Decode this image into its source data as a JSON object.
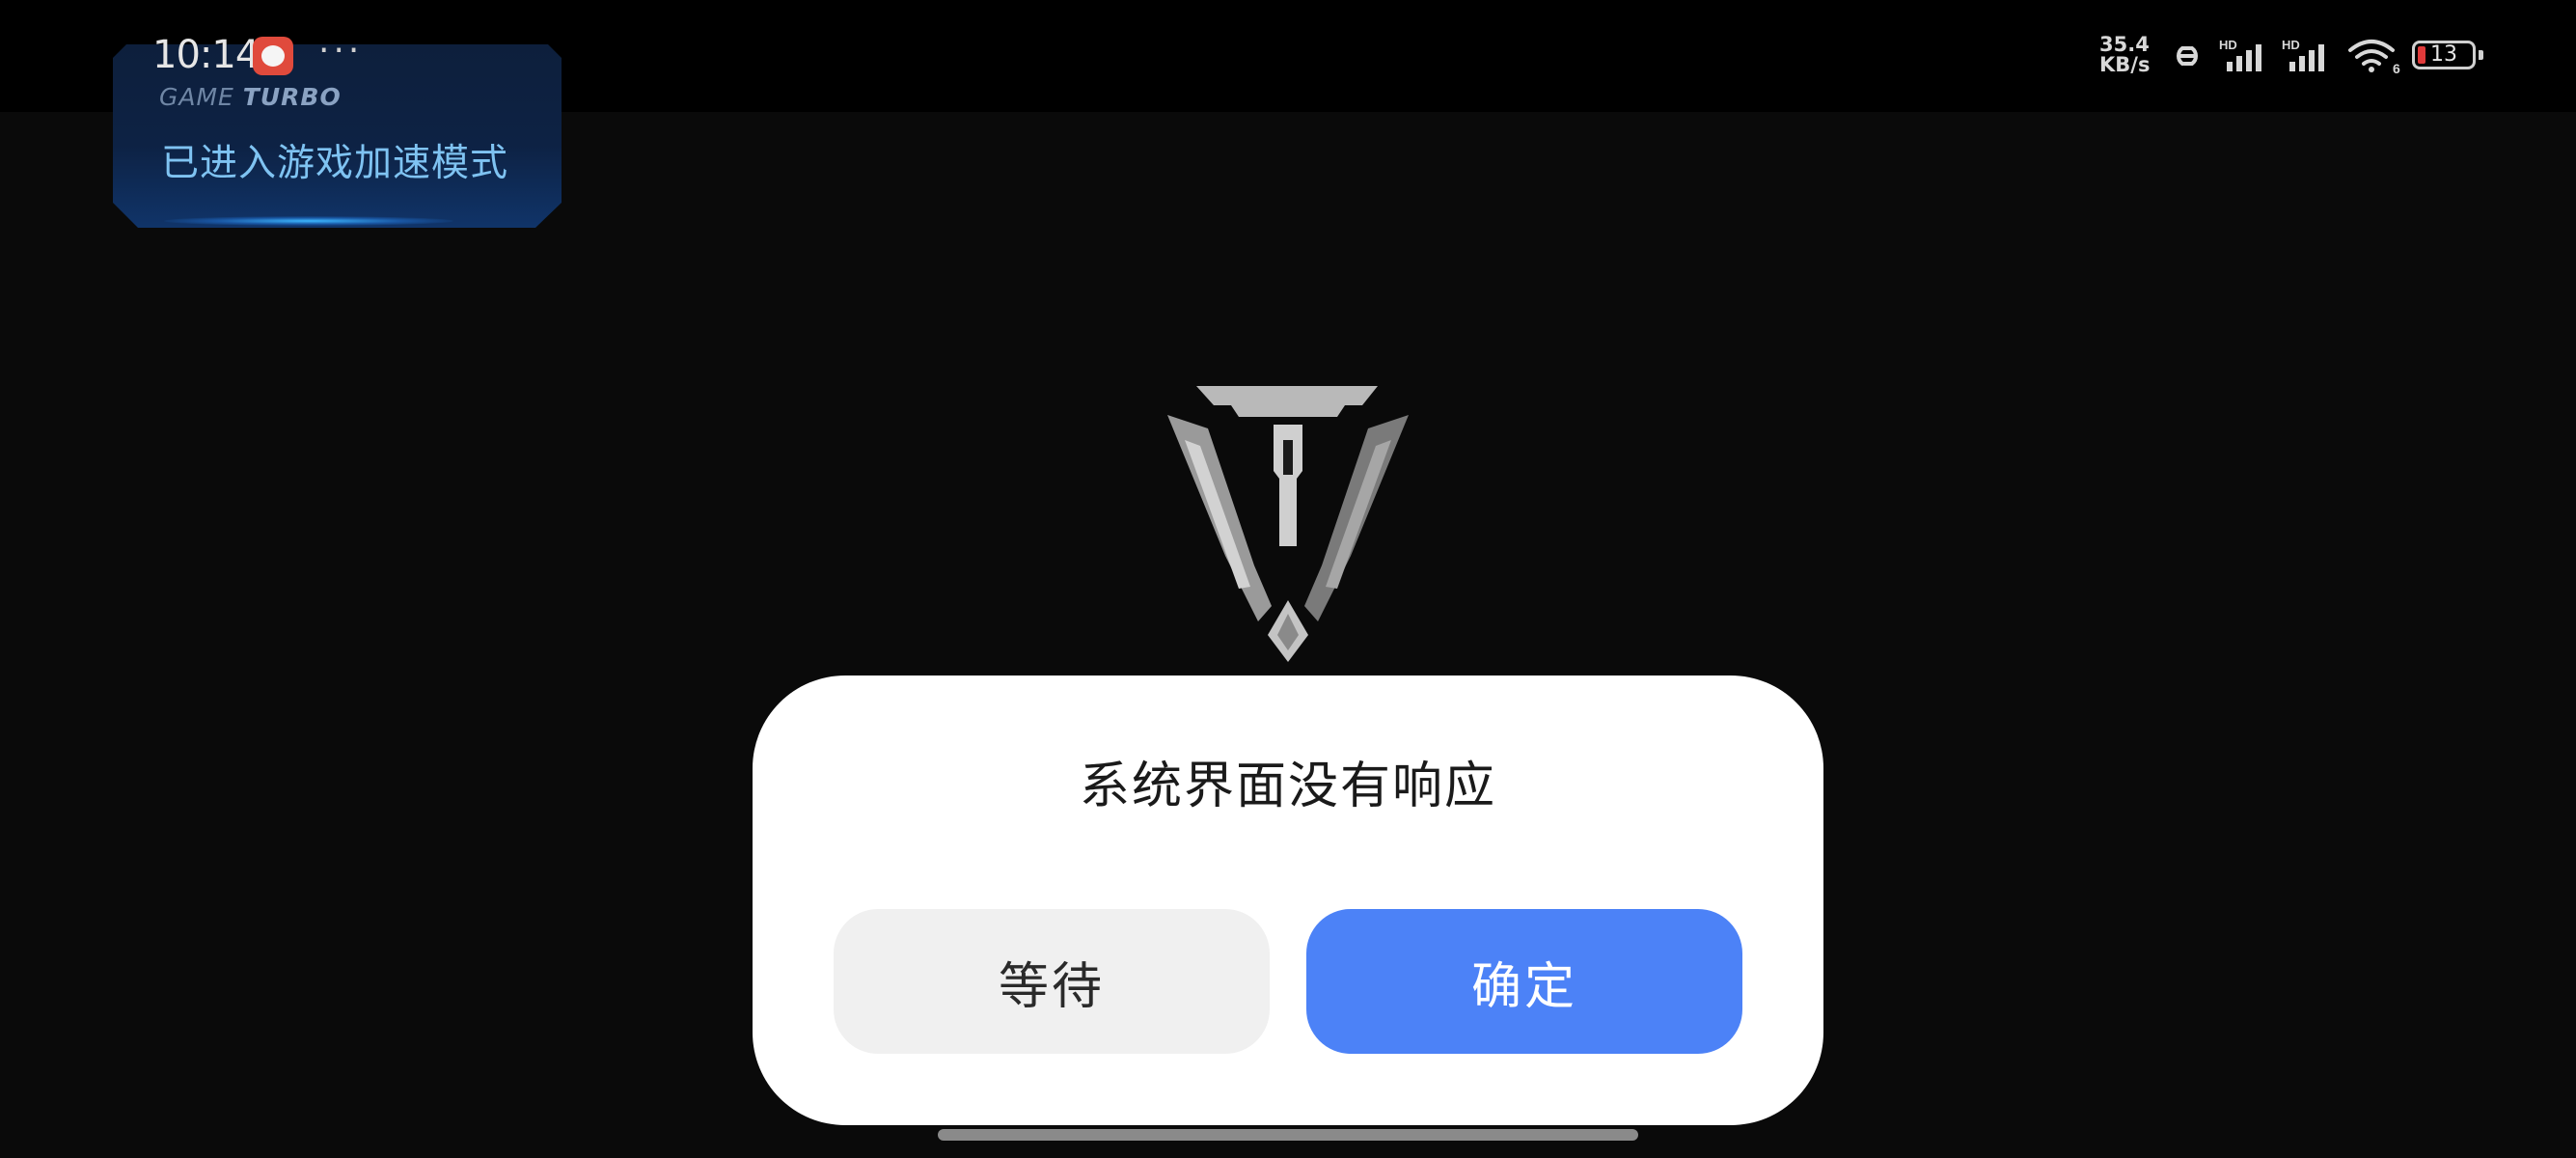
{
  "status_bar": {
    "time": "10:14",
    "more": "···",
    "net_speed_value": "35.4",
    "net_speed_unit": "KB/s",
    "hd_label": "HD",
    "wifi_sub": "6",
    "battery_level": "13"
  },
  "game_turbo": {
    "brand_game": "GAME",
    "brand_turbo": "TURBO",
    "message": "已进入游戏加速模式"
  },
  "dialog": {
    "title": "系统界面没有响应",
    "wait_label": "等待",
    "ok_label": "确定"
  },
  "colors": {
    "accent": "#4c82f7",
    "battery_low": "#e03a3a"
  }
}
